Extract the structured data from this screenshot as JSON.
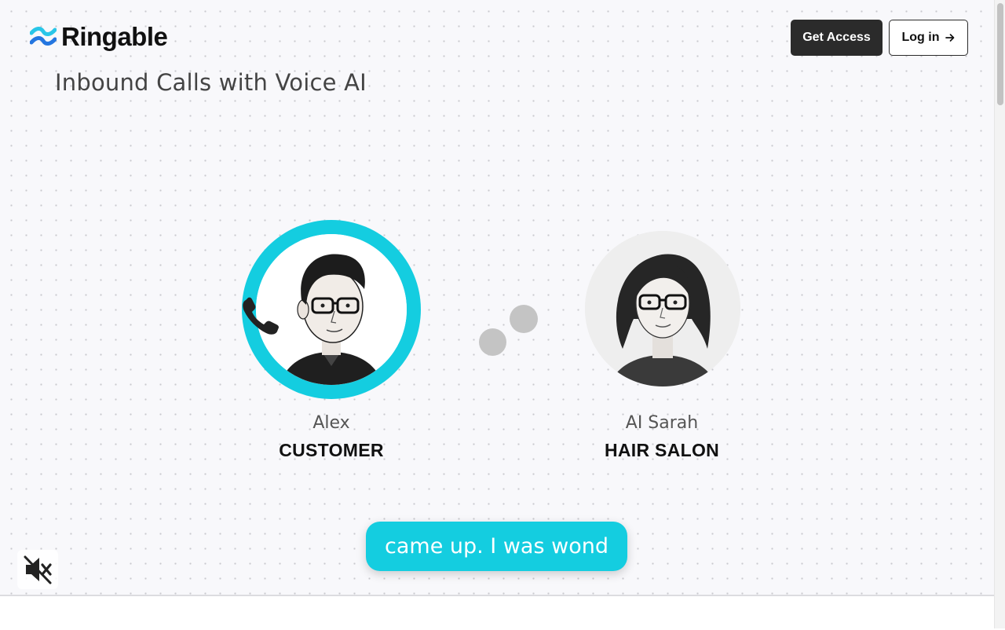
{
  "header": {
    "brand": "Ringable",
    "tagline": "Inbound Calls with Voice AI",
    "get_access_label": "Get Access",
    "login_label": "Log in"
  },
  "call": {
    "customer": {
      "name": "Alex",
      "role": "CUSTOMER"
    },
    "agent": {
      "name": "AI Sarah",
      "role": "HAIR SALON"
    },
    "caption": "came up. I was wond"
  },
  "icons": {
    "logo": "wave-logo-icon",
    "login_arrow": "arrow-right-icon",
    "phone": "phone-icon",
    "mute": "speaker-muted-icon"
  },
  "colors": {
    "accent": "#14cde0",
    "logo_light": "#29c6e8",
    "logo_dark": "#2476e0",
    "primary_button": "#2b2b2b"
  }
}
